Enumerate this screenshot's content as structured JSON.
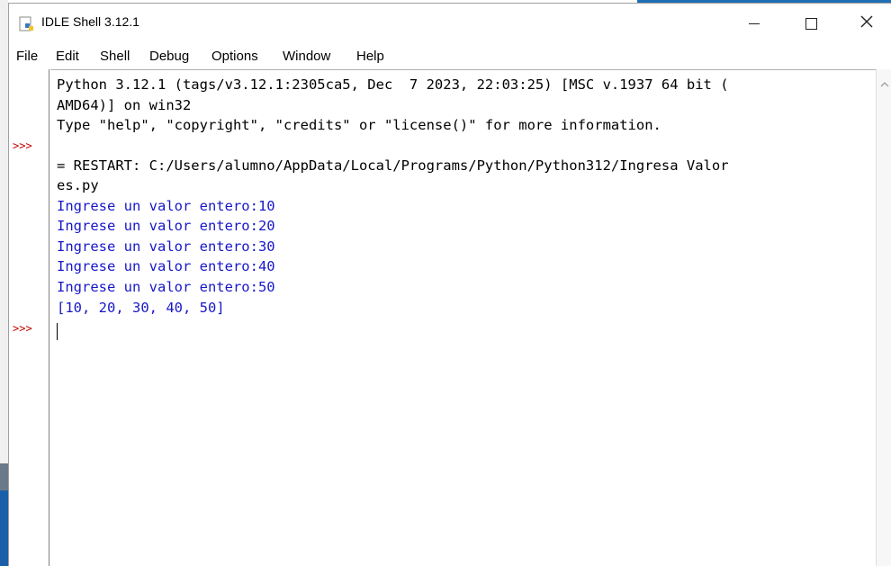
{
  "window": {
    "title": "IDLE Shell 3.12.1",
    "icon": "idle-python-icon",
    "controls": {
      "minimize": "minimize-icon",
      "maximize": "maximize-icon",
      "close": "close-icon"
    }
  },
  "menu": {
    "items": [
      {
        "label": "File"
      },
      {
        "label": "Edit"
      },
      {
        "label": "Shell"
      },
      {
        "label": "Debug"
      },
      {
        "label": "Options"
      },
      {
        "label": "Window"
      },
      {
        "label": "Help"
      }
    ]
  },
  "gutter": {
    "prompts": [
      ">>>",
      ">>>"
    ]
  },
  "shell": {
    "lines": [
      {
        "text": "Python 3.12.1 (tags/v3.12.1:2305ca5, Dec  7 2023, 22:03:25) [MSC v.1937 64 bit (",
        "style": "output"
      },
      {
        "text": "AMD64)] on win32",
        "style": "output"
      },
      {
        "text": "Type \"help\", \"copyright\", \"credits\" or \"license()\" for more information.",
        "style": "output"
      },
      {
        "text": "= RESTART: C:/Users/alumno/AppData/Local/Programs/Python/Python312/Ingresa Valor",
        "style": "output"
      },
      {
        "text": "es.py",
        "style": "output"
      },
      {
        "text": "Ingrese un valor entero:10",
        "style": "stdout"
      },
      {
        "text": "Ingrese un valor entero:20",
        "style": "stdout"
      },
      {
        "text": "Ingrese un valor entero:30",
        "style": "stdout"
      },
      {
        "text": "Ingrese un valor entero:40",
        "style": "stdout"
      },
      {
        "text": "Ingrese un valor entero:50",
        "style": "stdout"
      },
      {
        "text": "[10, 20, 30, 40, 50]",
        "style": "stdout"
      }
    ]
  },
  "colors": {
    "prompt": "#c00000",
    "stdout": "#1717c8",
    "text": "#000000"
  }
}
